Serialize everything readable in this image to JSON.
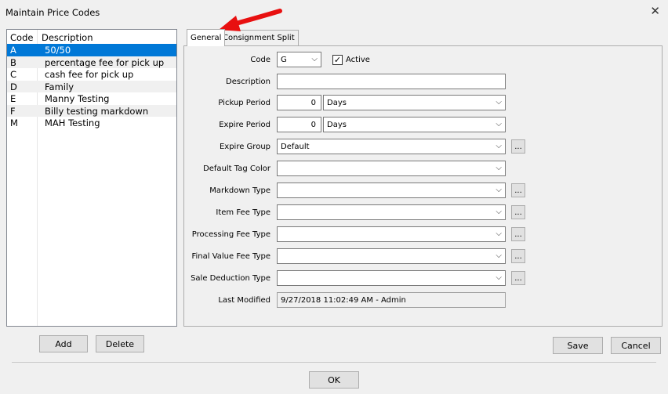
{
  "window": {
    "title": "Maintain Price Codes",
    "close": "✕"
  },
  "list": {
    "headers": {
      "code": "Code",
      "description": "Description"
    },
    "rows": [
      {
        "code": "A",
        "description": "50/50"
      },
      {
        "code": "B",
        "description": "percentage fee for pick up"
      },
      {
        "code": "C",
        "description": "cash fee for pick up"
      },
      {
        "code": "D",
        "description": "Family"
      },
      {
        "code": "E",
        "description": "Manny Testing"
      },
      {
        "code": "F",
        "description": "Billy testing markdown"
      },
      {
        "code": "M",
        "description": "MAH Testing"
      }
    ],
    "selected_index": 0
  },
  "buttons": {
    "add": "Add",
    "delete": "Delete",
    "save": "Save",
    "cancel": "Cancel",
    "ok": "OK",
    "ellipsis": "..."
  },
  "tabs": {
    "general": "General",
    "consignment_split": "Consignment Split"
  },
  "form": {
    "code_label": "Code",
    "code_value": "G",
    "active_label": "Active",
    "active_checked": "✓",
    "description_label": "Description",
    "description_value": "",
    "pickup_period_label": "Pickup Period",
    "pickup_period_value": "0",
    "pickup_period_unit": "Days",
    "expire_period_label": "Expire Period",
    "expire_period_value": "0",
    "expire_period_unit": "Days",
    "expire_group_label": "Expire Group",
    "expire_group_value": "Default",
    "default_tag_color_label": "Default Tag Color",
    "default_tag_color_value": "",
    "markdown_type_label": "Markdown Type",
    "markdown_type_value": "",
    "item_fee_type_label": "Item Fee Type",
    "item_fee_type_value": "",
    "processing_fee_type_label": "Processing Fee Type",
    "processing_fee_type_value": "",
    "final_value_fee_type_label": "Final Value Fee Type",
    "final_value_fee_type_value": "",
    "sale_deduction_type_label": "Sale Deduction Type",
    "sale_deduction_type_value": "",
    "last_modified_label": "Last Modified",
    "last_modified_value": "9/27/2018 11:02:49 AM - Admin"
  },
  "icons": {
    "chevron": "chevron-down-icon",
    "arrow": "red-arrow-annotation-icon",
    "check": "checkmark-icon"
  },
  "colors": {
    "selection": "#0078d7",
    "arrow": "#e81010"
  }
}
